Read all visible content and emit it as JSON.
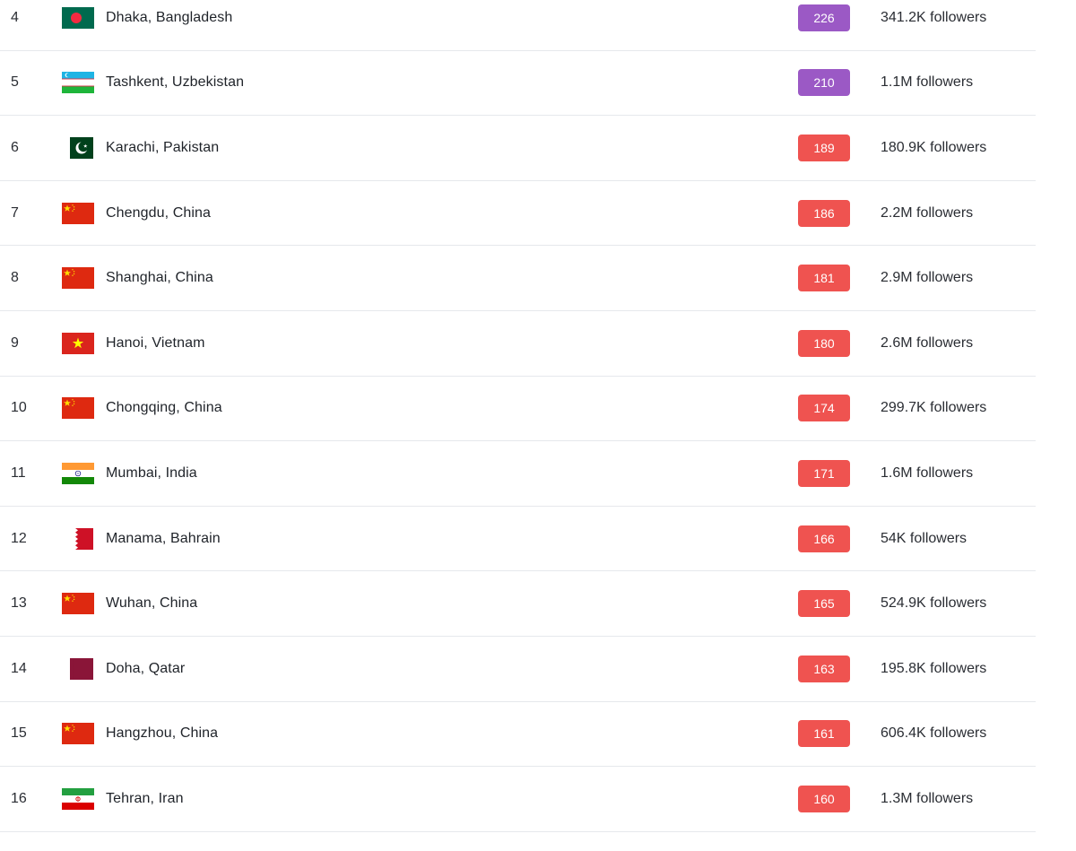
{
  "rows": [
    {
      "rank": "4",
      "city": "Dhaka, Bangladesh",
      "score": "226",
      "score_color": "#9b59c5",
      "followers": "341.2K followers",
      "flag": "bangladesh-flag-icon"
    },
    {
      "rank": "5",
      "city": "Tashkent, Uzbekistan",
      "score": "210",
      "score_color": "#9b59c5",
      "followers": "1.1M followers",
      "flag": "uzbekistan-flag-icon"
    },
    {
      "rank": "6",
      "city": "Karachi, Pakistan",
      "score": "189",
      "score_color": "#ef5350",
      "followers": "180.9K followers",
      "flag": "pakistan-flag-icon"
    },
    {
      "rank": "7",
      "city": "Chengdu, China",
      "score": "186",
      "score_color": "#ef5350",
      "followers": "2.2M followers",
      "flag": "china-flag-icon"
    },
    {
      "rank": "8",
      "city": "Shanghai, China",
      "score": "181",
      "score_color": "#ef5350",
      "followers": "2.9M followers",
      "flag": "china-flag-icon"
    },
    {
      "rank": "9",
      "city": "Hanoi, Vietnam",
      "score": "180",
      "score_color": "#ef5350",
      "followers": "2.6M followers",
      "flag": "vietnam-flag-icon"
    },
    {
      "rank": "10",
      "city": "Chongqing, China",
      "score": "174",
      "score_color": "#ef5350",
      "followers": "299.7K followers",
      "flag": "china-flag-icon"
    },
    {
      "rank": "11",
      "city": "Mumbai, India",
      "score": "171",
      "score_color": "#ef5350",
      "followers": "1.6M followers",
      "flag": "india-flag-icon"
    },
    {
      "rank": "12",
      "city": "Manama, Bahrain",
      "score": "166",
      "score_color": "#ef5350",
      "followers": "54K followers",
      "flag": "bahrain-flag-icon"
    },
    {
      "rank": "13",
      "city": "Wuhan, China",
      "score": "165",
      "score_color": "#ef5350",
      "followers": "524.9K followers",
      "flag": "china-flag-icon"
    },
    {
      "rank": "14",
      "city": "Doha, Qatar",
      "score": "163",
      "score_color": "#ef5350",
      "followers": "195.8K followers",
      "flag": "qatar-flag-icon"
    },
    {
      "rank": "15",
      "city": "Hangzhou, China",
      "score": "161",
      "score_color": "#ef5350",
      "followers": "606.4K followers",
      "flag": "china-flag-icon"
    },
    {
      "rank": "16",
      "city": "Tehran, Iran",
      "score": "160",
      "score_color": "#ef5350",
      "followers": "1.3M followers",
      "flag": "iran-flag-icon"
    }
  ]
}
